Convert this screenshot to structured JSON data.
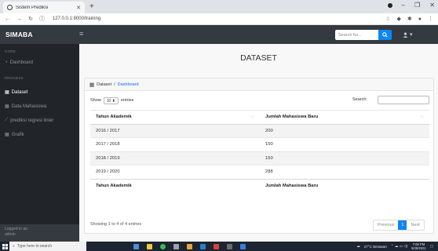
{
  "browser": {
    "tab_title": "Sistem Prediksi",
    "url": "127.0.0.1:8000/training"
  },
  "navbar": {
    "brand": "SIMABA",
    "search_placeholder": "Search for..."
  },
  "sidebar": {
    "heading_core": "CORE",
    "heading_process": "PROCESS",
    "items": [
      {
        "label": "Dashboard",
        "icon": "gauge-icon"
      },
      {
        "label": "Dataset",
        "icon": "table-icon",
        "active": true
      },
      {
        "label": "Data Mahasiswa",
        "icon": "table-icon"
      },
      {
        "label": "prediksi regresi linier",
        "icon": "chart-line-icon"
      },
      {
        "label": "Grafik",
        "icon": "table-icon"
      }
    ],
    "footer_line1": "Logged in as:",
    "footer_line2": "admin"
  },
  "main": {
    "title": "DATASET",
    "breadcrumb_current": "Dataset",
    "breadcrumb_sep": "/",
    "breadcrumb_link": "Dashboard",
    "show_label": "Show",
    "entries_value": "10",
    "entries_label": "entries",
    "search_label": "Search:",
    "table": {
      "columns": [
        "Tahun Akademik",
        "Jumlah Mahasiswa Baru"
      ],
      "rows": [
        [
          "2016 / 2017",
          "200"
        ],
        [
          "2017 / 2018",
          "150"
        ],
        [
          "2018 / 2019",
          "150"
        ],
        [
          "2019 / 2020",
          "288"
        ]
      ]
    },
    "info": "Showing 1 to 4 of 4 entries",
    "pager": {
      "previous": "Previous",
      "current": "1",
      "next": "Next"
    }
  },
  "taskbar": {
    "search_placeholder": "Type here to search",
    "weather": "27°C Berawan",
    "time": "7:08 PM",
    "date": "9/29/2021"
  },
  "colors": {
    "accent": "#0d86f5",
    "sidebar": "#212529",
    "navbar": "#343a40"
  }
}
